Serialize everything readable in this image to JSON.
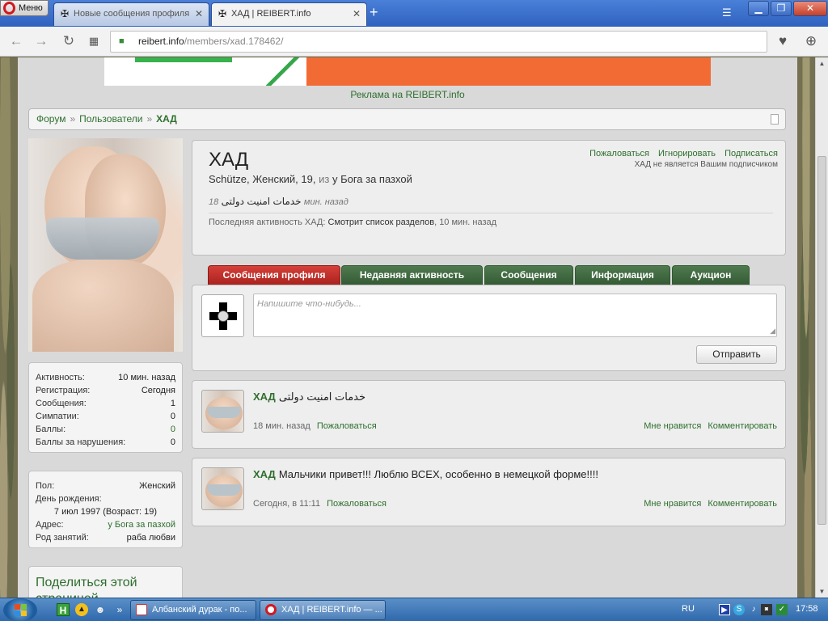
{
  "browser": {
    "menu_label": "Меню",
    "tabs": [
      {
        "title": "Новые сообщения профиля",
        "icon": "iron-cross-icon",
        "active": false
      },
      {
        "title": "ХАД | REIBERT.info",
        "icon": "iron-cross-icon",
        "active": true
      }
    ],
    "address": {
      "domain": "reibert.info",
      "path": "/members/xad.178462/"
    }
  },
  "page": {
    "ad_text": "Реклама на REIBERT.info",
    "breadcrumb": {
      "items": [
        "Форум",
        "Пользователи"
      ],
      "current": "ХАД"
    },
    "stats": [
      {
        "label": "Активность:",
        "value": "10 мин. назад"
      },
      {
        "label": "Регистрация:",
        "value": "Сегодня"
      },
      {
        "label": "Сообщения:",
        "value": "1"
      },
      {
        "label": "Симпатии:",
        "value": "0"
      },
      {
        "label": "Баллы:",
        "value": "0"
      },
      {
        "label": "Баллы за нарушения:",
        "value": "0"
      }
    ],
    "info": {
      "gender_label": "Пол:",
      "gender": "Женский",
      "birthday_label": "День рождения:",
      "birthday": "7 июл 1997 (Возраст: 19)",
      "address_label": "Адрес:",
      "address": "у Бога за пазхой",
      "occupation_label": "Род занятий:",
      "occupation": "раба любви"
    },
    "share_title": "Поделиться этой страницей",
    "profile": {
      "name": "ХАД",
      "desc_main": "Schütze, Женский, 19,",
      "desc_from": "из",
      "desc_place": "у Бога за пазхой",
      "status_num": "18",
      "status_text": "خدمات امنیت دولتی",
      "status_time": "мин. назад",
      "last_label": "Последняя активность ХАД:",
      "last_action": "Смотрит список разделов",
      "last_time": ", 10 мин. назад",
      "actions": [
        "Пожаловаться",
        "Игнорировать",
        "Подписаться"
      ],
      "not_following": "ХАД не является Вашим подписчиком"
    },
    "tabs": [
      "Сообщения профиля",
      "Недавняя активность",
      "Сообщения",
      "Информация",
      "Аукцион"
    ],
    "post": {
      "placeholder": "Напишите что-нибудь...",
      "send": "Отправить"
    },
    "messages": [
      {
        "author": "ХАД",
        "text": "خدمات امنیت دولتی",
        "time": "18 мин. назад",
        "report": "Пожаловаться",
        "like": "Мне нравится",
        "comment": "Комментировать"
      },
      {
        "author": "ХАД",
        "text": "Мальчики привет!!! Люблю ВСЕХ, особенно в немецкой форме!!!!",
        "time": "Сегодня, в 11:11",
        "report": "Пожаловаться",
        "like": "Мне нравится",
        "comment": "Комментировать"
      }
    ]
  },
  "taskbar": {
    "tasks": [
      "Албанский дурак - по...",
      "ХАД | REIBERT.info — ..."
    ],
    "lang": "RU",
    "clock": "17:58"
  }
}
